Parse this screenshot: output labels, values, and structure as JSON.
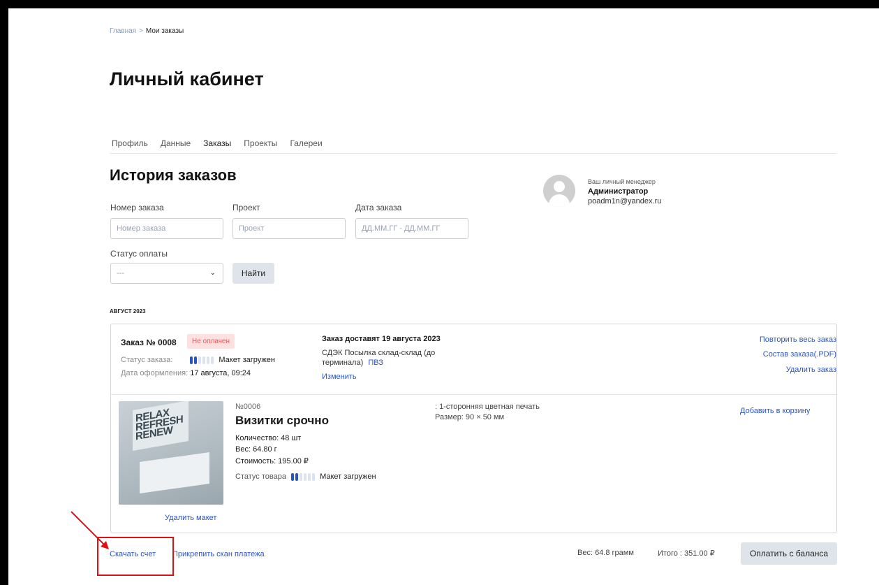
{
  "breadcrumb": {
    "home": "Главная",
    "separator": ">",
    "current": "Мои заказы"
  },
  "page_title": "Личный кабинет",
  "tabs": [
    "Профиль",
    "Данные",
    "Заказы",
    "Проекты",
    "Галереи"
  ],
  "section_title": "История заказов",
  "filters": {
    "order_number_label": "Номер заказа",
    "order_number_placeholder": "Номер заказа",
    "project_label": "Проект",
    "project_placeholder": "Проект",
    "date_label": "Дата заказа",
    "date_placeholder": "ДД.ММ.ГГ - ДД.ММ.ГГ",
    "payment_status_label": "Статус оплаты",
    "payment_status_value": "---",
    "find_button": "Найти"
  },
  "manager": {
    "caption": "Ваш личный менеджер",
    "name": "Администратор",
    "email": "poadm1n@yandex.ru"
  },
  "month_group": "АВГУСТ 2023",
  "order": {
    "number": "Заказ № 0008",
    "payment_badge": "Не оплачен",
    "status_label": "Статус заказа:",
    "status_value": "Макет загружен",
    "date_label": "Дата оформления:",
    "date_value": "17 августа, 09:24",
    "delivery_title": "Заказ доставят 19 августа 2023",
    "delivery_method": "СДЭК Посылка склад-склад (до терминала)",
    "delivery_point_link": "ПВЗ",
    "change_link": "Изменить",
    "repeat_link": "Повторить весь заказ",
    "composition_link": "Состав заказа(.PDF)",
    "delete_link": "Удалить заказ",
    "accent_color": "#2a55c0",
    "badge_color": "#fde1e1"
  },
  "product": {
    "thumbnail_text": "RELAX REFRESH RENEW",
    "number": "№0006",
    "title": "Визитки срочно",
    "quantity": "Количество: 48 шт",
    "weight": "Вес: 64.80 г",
    "cost": "Стоимость: 195.00 ₽",
    "status_label": "Статус товара",
    "status_value": "Макет загружен",
    "spec_print": ": 1-сторонняя цветная печать",
    "spec_size": "Размер: 90 × 50 мм",
    "add_to_cart": "Добавить в корзину",
    "delete_maket": "Удалить макет"
  },
  "footer": {
    "download_invoice": "Скачать счет",
    "attach_scan": "Прикрепить скан платежа",
    "weight": "Вес: 64.8 грамм",
    "total": "Итого : 351.00 ₽",
    "pay_button": "Оплатить с баланса"
  },
  "status_progress": {
    "filled": 2,
    "total": 6
  },
  "annotation_color": "#e01010"
}
